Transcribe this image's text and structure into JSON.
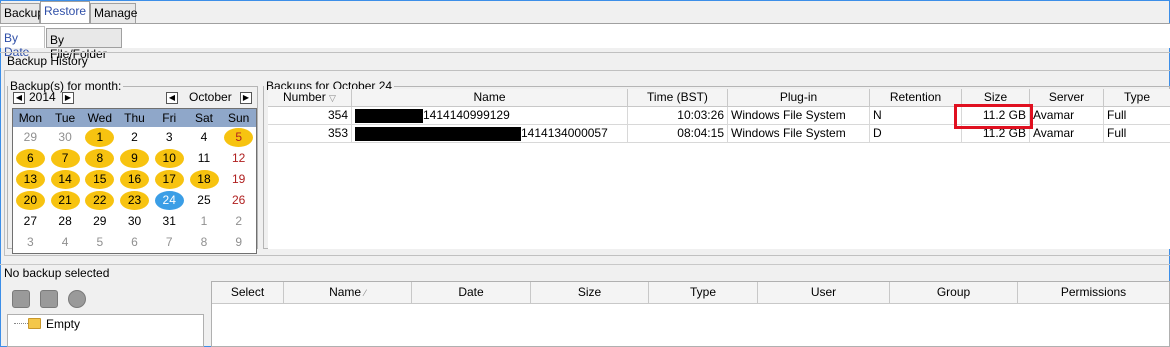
{
  "tabs": [
    {
      "label": "Backup",
      "active": false
    },
    {
      "label": "Restore",
      "active": true
    },
    {
      "label": "Manage",
      "active": false
    }
  ],
  "subtabs": [
    {
      "label": "By Date",
      "active": true
    },
    {
      "label": "By File/Folder",
      "active": false
    }
  ],
  "history": {
    "title": "Backup History",
    "month_legend": "Backup(s) for month:",
    "year": "2014",
    "month": "October",
    "weekdays": [
      "Mon",
      "Tue",
      "Wed",
      "Thu",
      "Fri",
      "Sat",
      "Sun"
    ],
    "weeks": [
      [
        {
          "d": "29",
          "o": true
        },
        {
          "d": "30",
          "o": true
        },
        {
          "d": "1",
          "b": true
        },
        {
          "d": "2"
        },
        {
          "d": "3"
        },
        {
          "d": "4"
        },
        {
          "d": "5",
          "b": true,
          "s": true
        }
      ],
      [
        {
          "d": "6",
          "b": true
        },
        {
          "d": "7",
          "b": true
        },
        {
          "d": "8",
          "b": true
        },
        {
          "d": "9",
          "b": true
        },
        {
          "d": "10",
          "b": true
        },
        {
          "d": "11"
        },
        {
          "d": "12",
          "s": true
        }
      ],
      [
        {
          "d": "13",
          "b": true
        },
        {
          "d": "14",
          "b": true
        },
        {
          "d": "15",
          "b": true
        },
        {
          "d": "16",
          "b": true
        },
        {
          "d": "17",
          "b": true
        },
        {
          "d": "18",
          "b": true
        },
        {
          "d": "19",
          "s": true
        }
      ],
      [
        {
          "d": "20",
          "b": true
        },
        {
          "d": "21",
          "b": true
        },
        {
          "d": "22",
          "b": true
        },
        {
          "d": "23",
          "b": true
        },
        {
          "d": "24",
          "sel": true
        },
        {
          "d": "25"
        },
        {
          "d": "26",
          "s": true
        }
      ],
      [
        {
          "d": "27"
        },
        {
          "d": "28"
        },
        {
          "d": "29"
        },
        {
          "d": "30"
        },
        {
          "d": "31"
        },
        {
          "d": "1",
          "o": true
        },
        {
          "d": "2",
          "o": true
        }
      ],
      [
        {
          "d": "3",
          "o": true
        },
        {
          "d": "4",
          "o": true
        },
        {
          "d": "5",
          "o": true
        },
        {
          "d": "6",
          "o": true
        },
        {
          "d": "7",
          "o": true
        },
        {
          "d": "8",
          "o": true
        },
        {
          "d": "9",
          "o": true
        }
      ]
    ]
  },
  "backups": {
    "legend": "Backups for October 24",
    "columns": [
      "Number",
      "Name",
      "Time (BST)",
      "Plug-in",
      "Retention",
      "Size",
      "Server",
      "Type"
    ],
    "rows": [
      {
        "number": "354",
        "name_suffix": "1414140999129",
        "time": "10:03:26",
        "plugin": "Windows File System",
        "retention": "N",
        "size": "11.2 GB",
        "server": "Avamar",
        "type": "Full"
      },
      {
        "number": "353",
        "name_suffix": "1414134000057",
        "time": "08:04:15",
        "plugin": "Windows File System",
        "retention": "D",
        "size": "11.2 GB",
        "server": "Avamar",
        "type": "Full"
      }
    ]
  },
  "status_text": "No backup selected",
  "tree_item": "Empty",
  "file_columns": [
    "Select",
    "Name",
    "Date",
    "Size",
    "Type",
    "User",
    "Group",
    "Permissions"
  ],
  "colors": {
    "backup_day": "#f7c310",
    "selected_day": "#3b9ee6",
    "highlight": "#e01020"
  }
}
